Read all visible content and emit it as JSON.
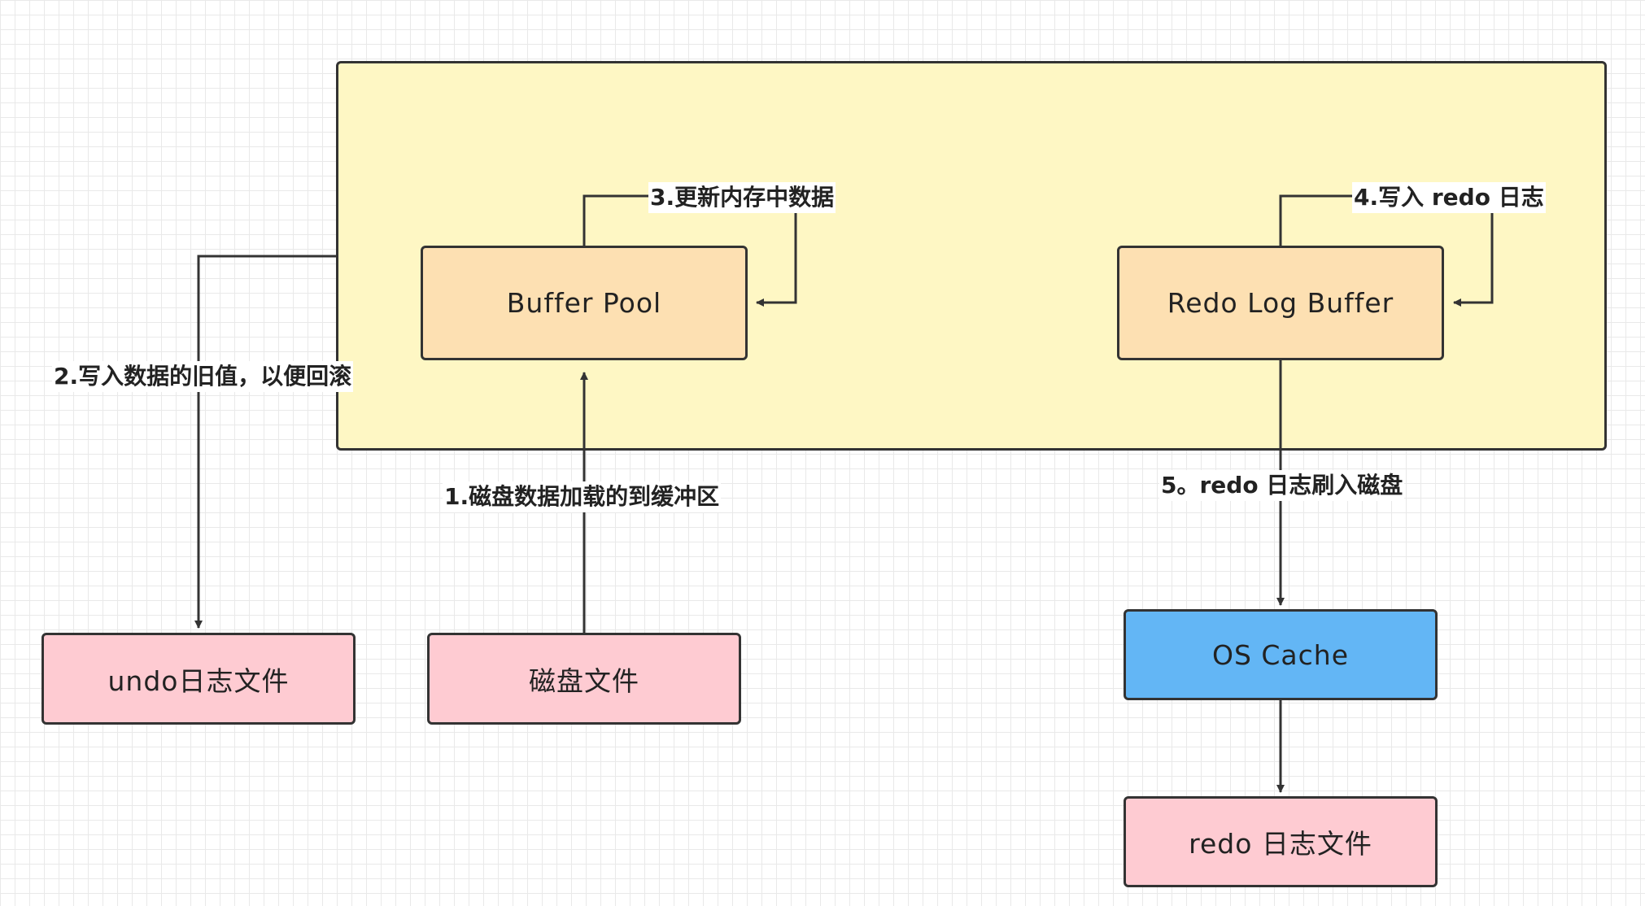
{
  "nodes": {
    "buffer_pool": "Buffer Pool",
    "redo_log_buffer": "Redo Log Buffer",
    "undo_file": "undo日志文件",
    "disk_file": "磁盘文件",
    "os_cache": "OS Cache",
    "redo_file": "redo 日志文件"
  },
  "edges": {
    "step1": "1.磁盘数据加载的到缓冲区",
    "step2": "2.写入数据的旧值，以便回滚",
    "step3": "3.更新内存中数据",
    "step4": "4.写入 redo 日志",
    "step5": "5。redo 日志刷入磁盘"
  },
  "colors": {
    "container_fill": "#fef7c4",
    "memory_fill": "#fde0b2",
    "file_fill": "#fecbd2",
    "cache_fill": "#63b6f5",
    "stroke": "#333333"
  }
}
